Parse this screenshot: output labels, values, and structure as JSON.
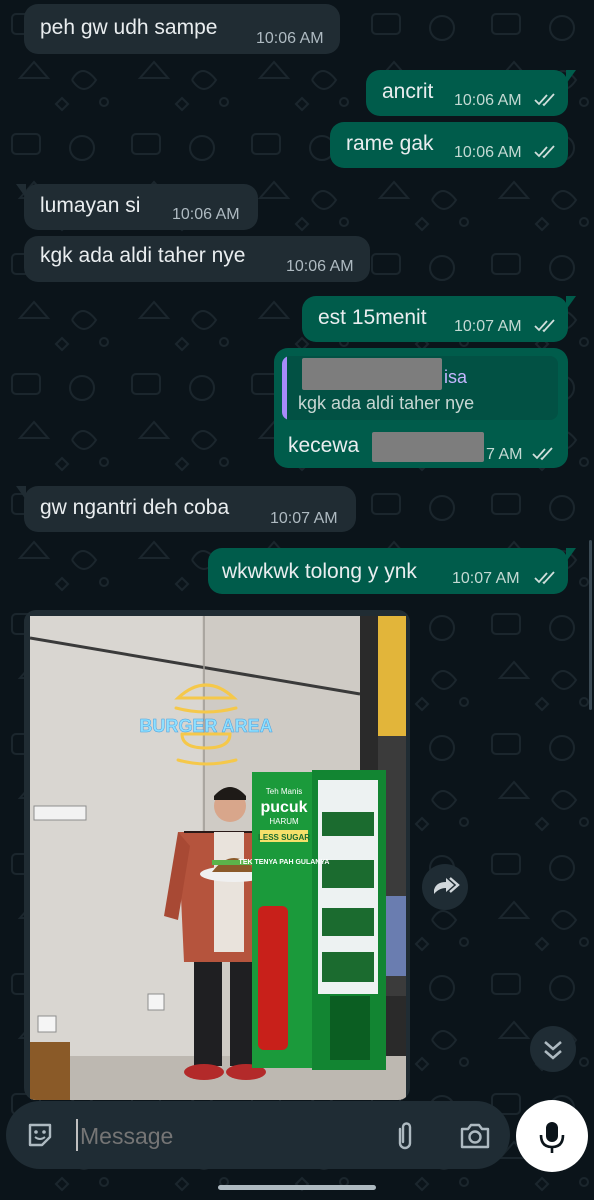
{
  "messages": [
    {
      "dir": "in",
      "text": "peh gw udh sampe",
      "time": "10:06 AM"
    },
    {
      "dir": "out",
      "text": "ancrit",
      "time": "10:06 AM"
    },
    {
      "dir": "out",
      "text": "rame gak",
      "time": "10:06 AM"
    },
    {
      "dir": "in",
      "text": "lumayan si",
      "time": "10:06 AM"
    },
    {
      "dir": "in",
      "text": "kgk ada aldi taher nye",
      "time": "10:06 AM"
    },
    {
      "dir": "out",
      "text": "est 15menit",
      "time": "10:07 AM"
    },
    {
      "dir": "out",
      "text": "kecewa",
      "time": "7 AM",
      "quote": {
        "sender_suffix": "isa",
        "text": "kgk ada aldi taher nye"
      }
    },
    {
      "dir": "in",
      "text": "gw ngantri deh coba",
      "time": "10:07 AM"
    },
    {
      "dir": "out",
      "text": "wkwkwk tolong y ynk",
      "time": "10:07 AM"
    }
  ],
  "photo": {
    "sign_line1": "BURGER AREA",
    "fridge_brand_small": "Teh Manis",
    "fridge_brand_big": "pucuk",
    "fridge_brand_sub": "HARUM",
    "fridge_band": "LESS SUGAR",
    "fridge_slogan": "TEK TENYA PAH GULANYA"
  },
  "composer": {
    "placeholder": "Message"
  },
  "colors": {
    "incoming": "#202c33",
    "outgoing": "#005c4b",
    "background": "#0b141a",
    "quote_accent": "#a78bfa"
  },
  "icons": [
    "sticker-icon",
    "attach-icon",
    "camera-icon",
    "mic-icon",
    "forward-icon",
    "scroll-down-icon",
    "double-check-icon"
  ]
}
